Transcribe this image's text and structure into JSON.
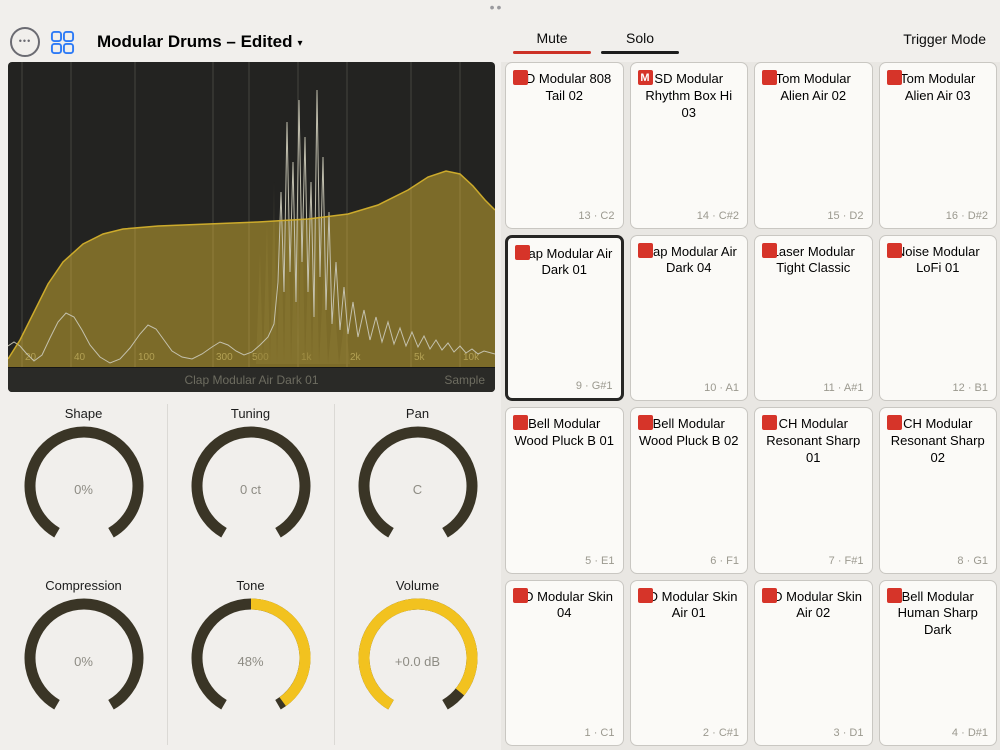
{
  "chrome": {
    "drag_dots": "•••"
  },
  "header": {
    "title": "Modular Drums – Edited",
    "caret": "▾"
  },
  "display": {
    "freq_labels": [
      "20",
      "40",
      "100",
      "300",
      "500",
      "1k",
      "2k",
      "5k",
      "10k"
    ],
    "sample_name": "Clap Modular Air Dark 01",
    "mode_label": "Sample"
  },
  "icons": {
    "ellipsis": "•••"
  },
  "knobs": [
    {
      "label": "Shape",
      "value": "0%",
      "pct": 0,
      "from_top": false
    },
    {
      "label": "Tuning",
      "value": "0 ct",
      "pct": 0,
      "from_top": true
    },
    {
      "label": "Pan",
      "value": "C",
      "pct": 0,
      "from_top": true
    },
    {
      "label": "Compression",
      "value": "0%",
      "pct": 0,
      "from_top": false
    },
    {
      "label": "Tone",
      "value": "48%",
      "pct": 0.48,
      "from_top": true
    },
    {
      "label": "Volume",
      "value": "+0.0 dB",
      "pct": 0.93,
      "from_top": false
    }
  ],
  "right_header": {
    "mute_label": "Mute",
    "solo_label": "Solo",
    "trigger_mode": "Trigger Mode",
    "mute_badge": "M"
  },
  "pads": [
    {
      "name": "SD Modular 808 Tail 02",
      "note": "13 · C2",
      "muted": false,
      "selected": false
    },
    {
      "name": "SD Modular Rhythm Box Hi 03",
      "note": "14 · C#2",
      "muted": true,
      "selected": false
    },
    {
      "name": "Tom Modular Alien Air 02",
      "note": "15 · D2",
      "muted": false,
      "selected": false
    },
    {
      "name": "Tom Modular Alien Air 03",
      "note": "16 · D#2",
      "muted": false,
      "selected": false
    },
    {
      "name": "Clap Modular Air Dark 01",
      "note": "9 · G#1",
      "muted": false,
      "selected": true
    },
    {
      "name": "Clap Modular Air Dark 04",
      "note": "10 · A1",
      "muted": false,
      "selected": false
    },
    {
      "name": "Laser Modular Tight Classic",
      "note": "11 · A#1",
      "muted": false,
      "selected": false
    },
    {
      "name": "Noise Modular LoFi 01",
      "note": "12 · B1",
      "muted": false,
      "selected": false
    },
    {
      "name": "Bell Modular Wood Pluck B 01",
      "note": "5 · E1",
      "muted": false,
      "selected": false
    },
    {
      "name": "Bell Modular Wood Pluck B 02",
      "note": "6 · F1",
      "muted": false,
      "selected": false
    },
    {
      "name": "CH Modular Resonant Sharp 01",
      "note": "7 · F#1",
      "muted": false,
      "selected": false
    },
    {
      "name": "CH Modular Resonant Sharp 02",
      "note": "8 · G1",
      "muted": false,
      "selected": false
    },
    {
      "name": "BD Modular Skin 04",
      "note": "1 · C1",
      "muted": false,
      "selected": false
    },
    {
      "name": "BD Modular Skin Air 01",
      "note": "2 · C#1",
      "muted": false,
      "selected": false
    },
    {
      "name": "BD Modular Skin Air 02",
      "note": "3 · D1",
      "muted": false,
      "selected": false
    },
    {
      "name": "Bell Modular Human Sharp Dark",
      "note": "4 · D#1",
      "muted": false,
      "selected": false
    }
  ],
  "colors": {
    "accent_yellow": "#f2c21f",
    "knob_track": "#3a3526",
    "mute_red": "#cc3126",
    "badge_red": "#d63429",
    "selected_border": "#262624",
    "icon_blue": "#2e7bf6",
    "display_bg": "#232321"
  }
}
